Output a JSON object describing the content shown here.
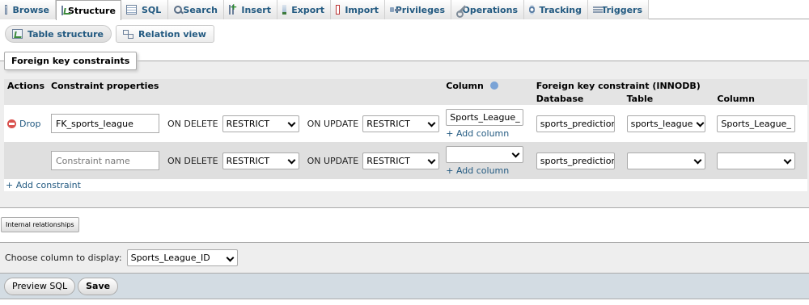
{
  "tabs": [
    {
      "label": "Browse",
      "icon": "browse-icon"
    },
    {
      "label": "Structure",
      "icon": "structure-icon",
      "active": true
    },
    {
      "label": "SQL",
      "icon": "sql-icon"
    },
    {
      "label": "Search",
      "icon": "search-icon"
    },
    {
      "label": "Insert",
      "icon": "insert-icon"
    },
    {
      "label": "Export",
      "icon": "export-icon"
    },
    {
      "label": "Import",
      "icon": "import-icon"
    },
    {
      "label": "Privileges",
      "icon": "privileges-icon"
    },
    {
      "label": "Operations",
      "icon": "operations-icon"
    },
    {
      "label": "Tracking",
      "icon": "tracking-icon"
    },
    {
      "label": "Triggers",
      "icon": "triggers-icon"
    }
  ],
  "subtabs": {
    "table_structure": "Table structure",
    "relation_view": "Relation view"
  },
  "fieldset": {
    "legend": "Foreign key constraints"
  },
  "table": {
    "headers": {
      "actions": "Actions",
      "constraint_properties": "Constraint properties",
      "column": "Column",
      "foreign_key": "Foreign key constraint (INNODB)",
      "database": "Database",
      "table": "Table",
      "fk_column": "Column"
    },
    "rows": [
      {
        "action": "Drop",
        "constraint_name": "FK_sports_league",
        "on_delete_label": "ON DELETE",
        "on_delete": "RESTRICT",
        "on_update_label": "ON UPDATE",
        "on_update": "RESTRICT",
        "column": "Sports_League_",
        "add_column": "+ Add column",
        "database": "sports_predictior",
        "table": "sports_league",
        "fk_column": "Sports_League_"
      },
      {
        "constraint_placeholder": "Constraint name",
        "on_delete_label": "ON DELETE",
        "on_delete": "RESTRICT",
        "on_update_label": "ON UPDATE",
        "on_update": "RESTRICT",
        "column": "",
        "add_column": "+ Add column",
        "database": "sports_predictior",
        "table": "",
        "fk_column": ""
      }
    ],
    "add_constraint": "+ Add constraint"
  },
  "internal_relationships": "Internal relationships",
  "display": {
    "label": "Choose column to display:",
    "value": "Sports_League_ID"
  },
  "footer": {
    "preview_sql": "Preview SQL",
    "save": "Save"
  }
}
